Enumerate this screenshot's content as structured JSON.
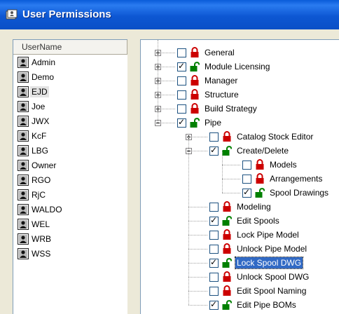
{
  "window": {
    "title": "User Permissions"
  },
  "users": {
    "header": "UserName",
    "selected_index": 2,
    "items": [
      "Admin",
      "Demo",
      "EJD",
      "Joe",
      "JWX",
      "KcF",
      "LBG",
      "Owner",
      "RGO",
      "RjC",
      "WALDO",
      "WEL",
      "WRB",
      "WSS"
    ]
  },
  "tree": {
    "nodes": [
      {
        "level": 0,
        "expander": "plus",
        "checked": false,
        "lock": "locked",
        "label": "General"
      },
      {
        "level": 0,
        "expander": "plus",
        "checked": true,
        "lock": "unlocked",
        "label": "Module Licensing"
      },
      {
        "level": 0,
        "expander": "plus",
        "checked": false,
        "lock": "locked",
        "label": "Manager"
      },
      {
        "level": 0,
        "expander": "plus",
        "checked": false,
        "lock": "locked",
        "label": "Structure"
      },
      {
        "level": 0,
        "expander": "plus",
        "checked": false,
        "lock": "locked",
        "label": "Build Strategy"
      },
      {
        "level": 0,
        "expander": "minus",
        "checked": true,
        "lock": "unlocked",
        "label": "Pipe"
      },
      {
        "level": 1,
        "expander": "plus",
        "checked": false,
        "lock": "locked",
        "label": "Catalog Stock Editor"
      },
      {
        "level": 1,
        "expander": "minus",
        "checked": true,
        "lock": "unlocked",
        "label": "Create/Delete"
      },
      {
        "level": 2,
        "expander": null,
        "checked": false,
        "lock": "locked",
        "label": "Models"
      },
      {
        "level": 2,
        "expander": null,
        "checked": false,
        "lock": "locked",
        "label": "Arrangements"
      },
      {
        "level": 2,
        "expander": null,
        "checked": true,
        "lock": "unlocked",
        "label": "Spool Drawings"
      },
      {
        "level": 1,
        "expander": null,
        "checked": false,
        "lock": "locked",
        "label": "Modeling"
      },
      {
        "level": 1,
        "expander": null,
        "checked": true,
        "lock": "unlocked",
        "label": "Edit Spools"
      },
      {
        "level": 1,
        "expander": null,
        "checked": false,
        "lock": "locked",
        "label": "Lock Pipe Model"
      },
      {
        "level": 1,
        "expander": null,
        "checked": false,
        "lock": "locked",
        "label": "Unlock Pipe Model"
      },
      {
        "level": 1,
        "expander": null,
        "checked": true,
        "lock": "unlocked",
        "label": "Lock Spool DWG",
        "selected": true
      },
      {
        "level": 1,
        "expander": null,
        "checked": false,
        "lock": "locked",
        "label": "Unlock Spool DWG"
      },
      {
        "level": 1,
        "expander": null,
        "checked": false,
        "lock": "locked",
        "label": "Edit Spool Naming"
      },
      {
        "level": 1,
        "expander": null,
        "checked": true,
        "lock": "unlocked",
        "label": "Edit Pipe BOMs"
      }
    ]
  },
  "colors": {
    "locked": "#cc0000",
    "unlocked": "#008000",
    "selection": "#316ac5",
    "titlebar": "#0a5cd9"
  },
  "icons": {
    "app": "user-permissions-icon",
    "user": "user-icon",
    "locked": "padlock-closed-icon",
    "unlocked": "padlock-open-icon"
  }
}
